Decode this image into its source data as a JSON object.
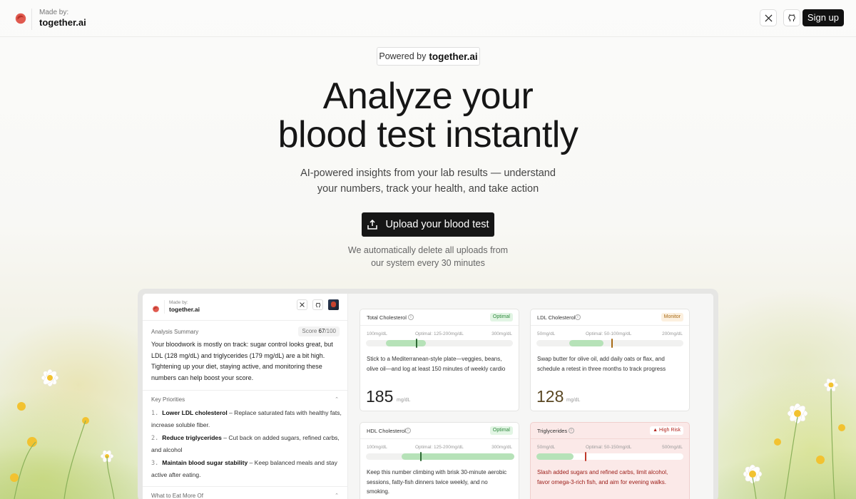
{
  "header": {
    "made_by_label": "Made by:",
    "brand": "together.ai",
    "x_icon": "x-logo-icon",
    "github_icon": "github-icon",
    "signup_label": "Sign up"
  },
  "hero": {
    "powered_prefix": "Powered by",
    "powered_brand": "together.ai",
    "title_line1": "Analyze your",
    "title_line2": "blood test instantly",
    "subtitle_line1": "AI-powered insights from your lab results — understand",
    "subtitle_line2": "your numbers, track your health, and take action",
    "upload_label": "Upload your blood test",
    "upload_icon": "upload-icon",
    "note_line1": "We automatically delete all uploads from",
    "note_line2": "our system every 30 minutes"
  },
  "preview": {
    "made_by_label": "Made by:",
    "brand": "together.ai",
    "summary_label": "Analysis Summary",
    "score_label": "Score",
    "score_value": "67",
    "score_max": "/100",
    "summary_text": "Your bloodwork is mostly on track: sugar control looks great, but LDL (128 mg/dL) and triglycerides (179 mg/dL) are a bit high. Tightening up your diet, staying active, and monitoring these numbers can help boost your score.",
    "priorities_label": "Key Priorities",
    "priorities": [
      {
        "num": "1.",
        "title": "Lower LDL cholesterol",
        "text": " – Replace saturated fats with healthy fats, increase soluble fiber."
      },
      {
        "num": "2.",
        "title": "Reduce triglycerides",
        "text": " – Cut back on added sugars, refined carbs, and alcohol"
      },
      {
        "num": "3.",
        "title": "Maintain blood sugar stability",
        "text": " – Keep balanced meals and stay active after eating."
      }
    ],
    "eat_more_label": "What to Eat More Of",
    "cards": [
      {
        "name": "Total Cholesterol",
        "status": "Optimal",
        "status_color": "#2f8a3e",
        "low": "100mg/dL",
        "optimal": "Optimal: 125-200mg/dL",
        "high": "300mg/dL",
        "tip": "Stick to a Mediterranean-style plate—veggies, beans, olive oil—and log at least 150 minutes of weekly cardio",
        "value": "185",
        "unit": "mg/dL"
      },
      {
        "name": "LDL Cholesterol",
        "status": "Monitor",
        "status_color": "#a86a16",
        "low": "50mg/dL",
        "optimal": "Optimal: 50-100mg/dL",
        "high": "200mg/dL",
        "tip": "Swap butter for olive oil, add daily oats or flax, and schedule a retest in three months to track progress",
        "value": "128",
        "unit": "mg/dL"
      },
      {
        "name": "HDL Cholesterol",
        "status": "Optimal",
        "status_color": "#2f8a3e",
        "low": "100mg/dL",
        "optimal": "Optimal: 125-200mg/dL",
        "high": "300mg/dL",
        "tip": "Keep this number climbing with brisk 30-minute aerobic sessions, fatty-fish dinners twice weekly, and no smoking."
      },
      {
        "name": "Triglycerides",
        "status": "High Risk",
        "status_icon": "alert-triangle-icon",
        "status_color": "#b3261e",
        "low": "50mg/dL",
        "optimal": "Optimal: 50-150mg/dL",
        "high": "500mg/dL",
        "tip": "Slash added sugars and refined carbs, limit alcohol, favor omega-3-rich fish, and aim for evening walks."
      }
    ]
  }
}
